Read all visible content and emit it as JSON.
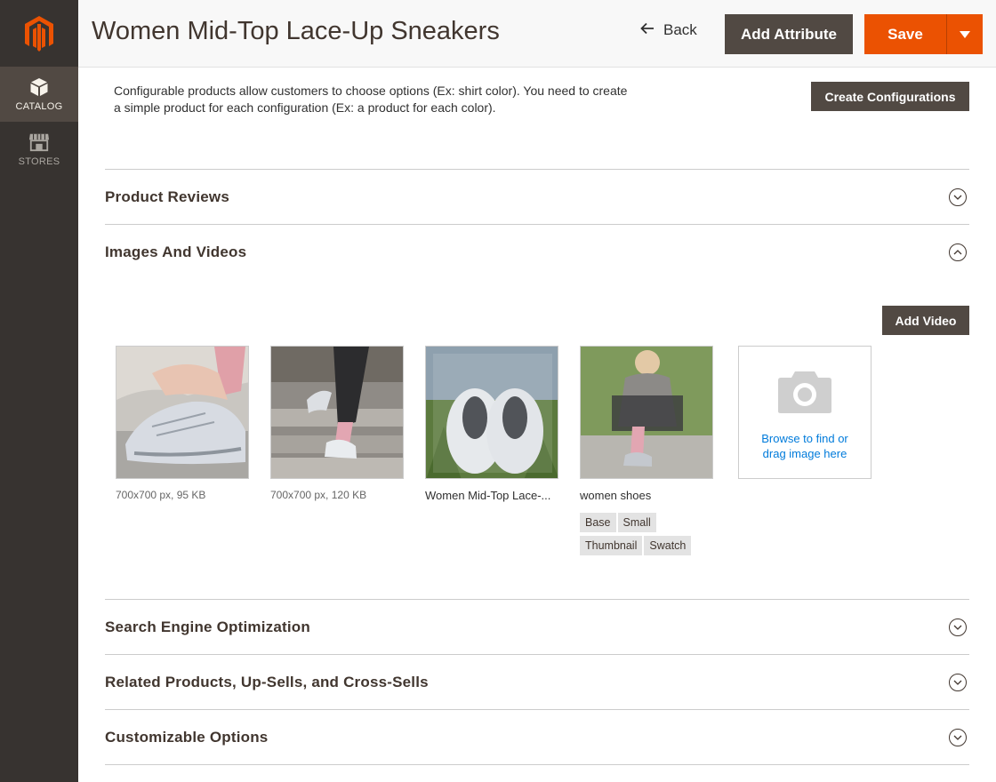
{
  "header": {
    "title": "Women Mid-Top Lace-Up Sneakers",
    "back_label": "Back",
    "add_attribute_label": "Add Attribute",
    "save_label": "Save"
  },
  "sidebar": {
    "items": [
      {
        "label": "CATALOG",
        "icon": "box-icon",
        "active": true
      },
      {
        "label": "STORES",
        "icon": "storefront-icon",
        "active": false
      }
    ]
  },
  "configurations": {
    "text": "Configurable products allow customers to choose options (Ex: shirt color). You need to create a simple product for each configuration (Ex: a product for each color).",
    "button_label": "Create Configurations"
  },
  "sections": [
    {
      "title": "Product Reviews",
      "expanded": false
    },
    {
      "title": "Images And Videos",
      "expanded": true
    },
    {
      "title": "Search Engine Optimization",
      "expanded": false
    },
    {
      "title": "Related Products, Up-Sells, and Cross-Sells",
      "expanded": false
    },
    {
      "title": "Customizable Options",
      "expanded": false
    }
  ],
  "images": {
    "add_video_label": "Add Video",
    "items": [
      {
        "caption": "700x700 px, 95 KB"
      },
      {
        "caption": "700x700 px, 120 KB"
      },
      {
        "caption": "Women Mid-Top Lace-..."
      },
      {
        "caption": "women shoes",
        "roles": [
          "Base",
          "Small",
          "Thumbnail",
          "Swatch"
        ]
      }
    ],
    "uploader_text": "Browse to find or drag image here"
  },
  "colors": {
    "sidebar_bg": "#373330",
    "accent_orange": "#eb5202",
    "dark_button": "#514943",
    "link_blue": "#007bdb"
  }
}
